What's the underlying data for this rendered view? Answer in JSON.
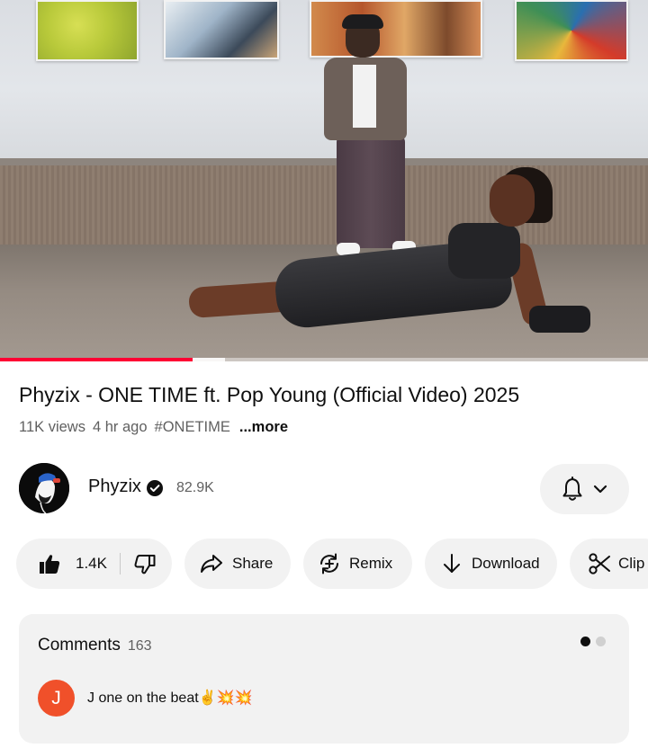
{
  "player": {
    "progress_played": 0.297,
    "progress_buffered": 0.347,
    "colors": {
      "played": "#ff0033"
    }
  },
  "video": {
    "title": "Phyzix - ONE TIME ft. Pop Young (Official Video) 2025",
    "views": "11K views",
    "age": "4 hr ago",
    "hashtag": "#ONETIME",
    "more_label": "...more"
  },
  "channel": {
    "name": "Phyzix",
    "verified_icon": "verified-badge-icon",
    "subscribers": "82.9K",
    "notification_icon": "bell-icon"
  },
  "actions": {
    "likes": "1.4K",
    "share_label": "Share",
    "remix_label": "Remix",
    "download_label": "Download",
    "clip_label": "Clip"
  },
  "comments": {
    "title": "Comments",
    "count": "163",
    "carousel_dots": 2,
    "active_dot": 0,
    "top_comment": {
      "avatar_letter": "J",
      "avatar_color": "#f0502a",
      "text": "J one on the beat✌️💥💥"
    }
  }
}
